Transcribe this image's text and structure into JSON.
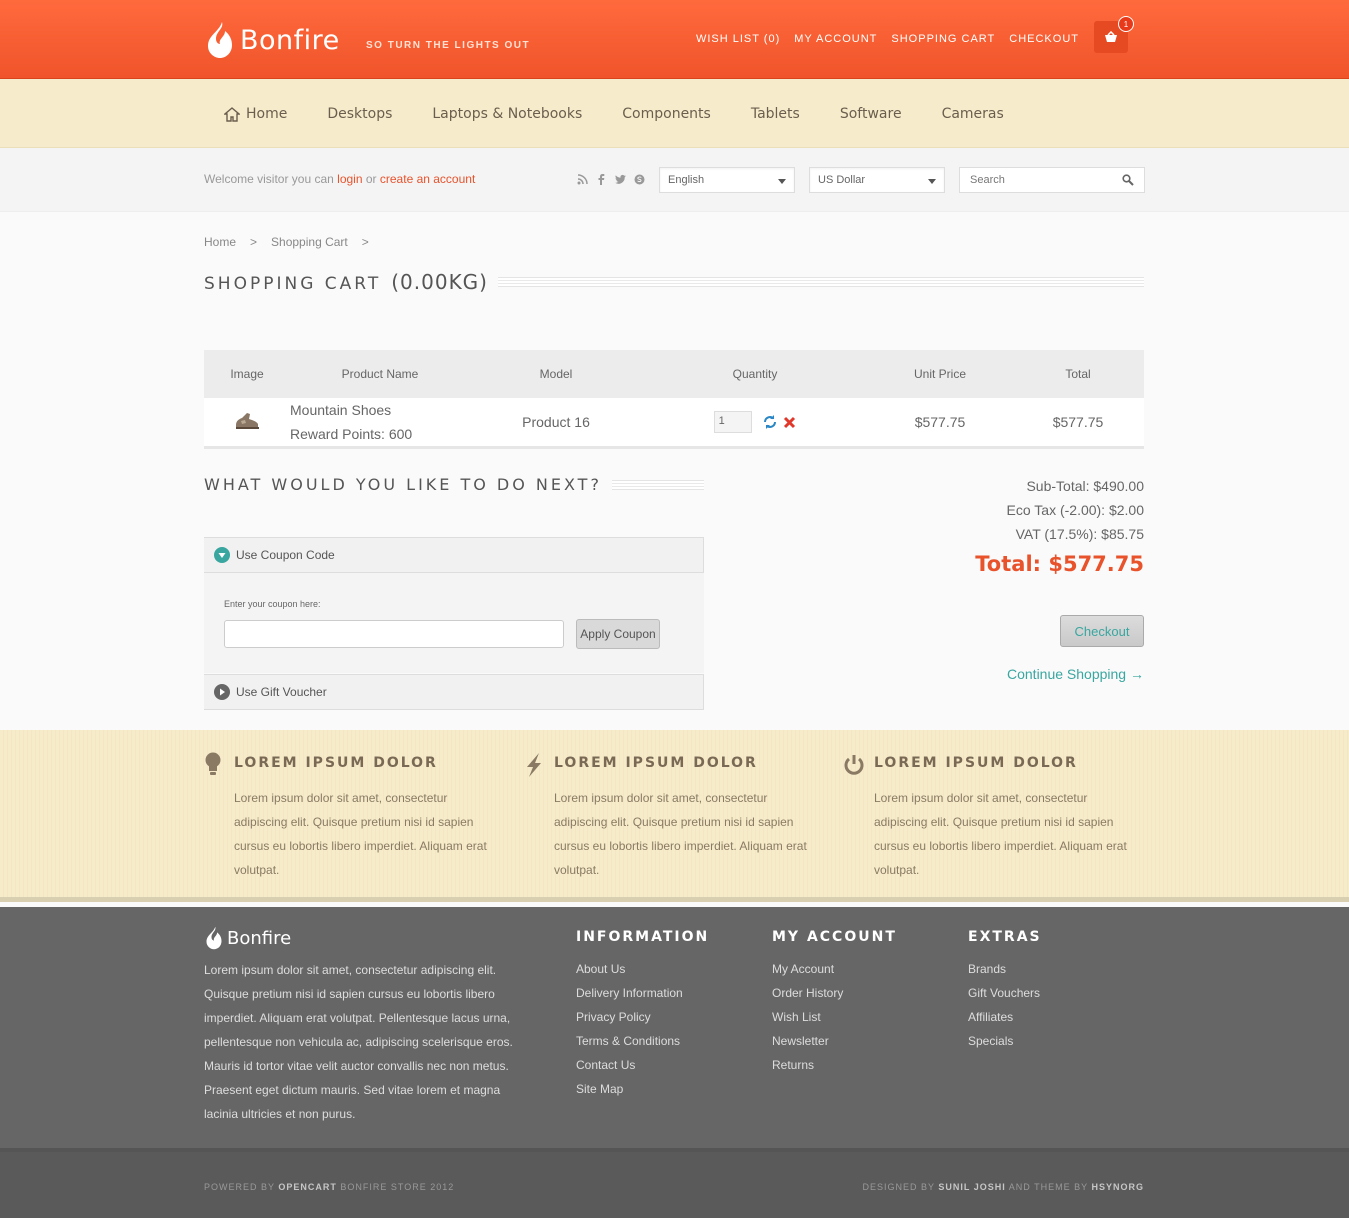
{
  "header": {
    "logo_text": "Bonfire",
    "tagline": "SO TURN THE LIGHTS OUT",
    "links": [
      "WISH LIST (0)",
      "MY ACCOUNT",
      "SHOPPING CART",
      "CHECKOUT"
    ],
    "cart_count": "1",
    "accent_color": "#f0542a"
  },
  "nav": {
    "items": [
      "Home",
      "Desktops",
      "Laptops & Notebooks",
      "Components",
      "Tablets",
      "Software",
      "Cameras"
    ]
  },
  "util": {
    "welcome_prefix": "Welcome visitor you can",
    "login": "login",
    "or": "or",
    "create": "create an account",
    "language": "English",
    "currency": "US Dollar",
    "search_placeholder": "Search",
    "social_icons": [
      "rss-icon",
      "facebook-icon",
      "twitter-icon",
      "skype-icon"
    ]
  },
  "breadcrumb": [
    "Home",
    ">",
    "Shopping Cart",
    ">"
  ],
  "page": {
    "title": "SHOPPING CART",
    "weight": "(0.00KG)"
  },
  "cart": {
    "headers": [
      "Image",
      "Product Name",
      "Model",
      "Quantity",
      "Unit Price",
      "Total"
    ],
    "rows": [
      {
        "name": "Mountain Shoes",
        "points": "Reward Points: 600",
        "model": "Product 16",
        "qty": "1",
        "unit_price": "$577.75",
        "total": "$577.75"
      }
    ]
  },
  "next": {
    "title": "WHAT WOULD YOU LIKE TO DO NEXT?",
    "coupon_title": "Use Coupon Code",
    "coupon_label": "Enter your coupon here:",
    "apply": "Apply Coupon",
    "voucher_title": "Use Gift Voucher"
  },
  "totals": {
    "subtotal": "Sub-Total: $490.00",
    "eco": "Eco Tax (-2.00): $2.00",
    "vat": "VAT (17.5%): $85.75",
    "total": "Total: $577.75",
    "checkout": "Checkout",
    "continue": "Continue Shopping →"
  },
  "features": [
    {
      "icon": "lightbulb-icon",
      "title": "LOREM IPSUM DOLOR",
      "text": "Lorem ipsum dolor sit amet, consectetur adipiscing elit. Quisque pretium nisi id sapien cursus eu lobortis libero imperdiet. Aliquam erat volutpat."
    },
    {
      "icon": "lightning-icon",
      "title": "LOREM IPSUM DOLOR",
      "text": "Lorem ipsum dolor sit amet, consectetur adipiscing elit. Quisque pretium nisi id sapien cursus eu lobortis libero imperdiet. Aliquam erat volutpat."
    },
    {
      "icon": "power-icon",
      "title": "LOREM IPSUM DOLOR",
      "text": "Lorem ipsum dolor sit amet, consectetur adipiscing elit. Quisque pretium nisi id sapien cursus eu lobortis libero imperdiet. Aliquam erat volutpat."
    }
  ],
  "footer": {
    "logo_text": "Bonfire",
    "about": "Lorem ipsum dolor sit amet, consectetur adipiscing elit. Quisque pretium nisi id sapien cursus eu lobortis libero imperdiet. Aliquam erat volutpat. Pellentesque lacus urna, pellentesque non vehicula ac, adipiscing scelerisque eros. Mauris id tortor vitae velit auctor convallis nec non metus. Praesent eget dictum mauris. Sed vitae lorem et magna lacinia ultricies et non purus.",
    "columns": [
      {
        "title": "INFORMATION",
        "items": [
          "About Us",
          "Delivery Information",
          "Privacy Policy",
          "Terms & Conditions",
          "Contact Us",
          "Site Map"
        ]
      },
      {
        "title": "MY ACCOUNT",
        "items": [
          "My Account",
          "Order History",
          "Wish List",
          "Newsletter",
          "Returns"
        ]
      },
      {
        "title": "EXTRAS",
        "items": [
          "Brands",
          "Gift Vouchers",
          "Affiliates",
          "Specials"
        ]
      }
    ],
    "powered_prefix": "POWERED BY",
    "powered_brand": "OPENCART",
    "powered_suffix": "BONFIRE STORE 2012",
    "designed_prefix": "DESIGNED BY",
    "designer": "SUNIL JOSHI",
    "theme_mid": "AND THEME BY",
    "theme_author": "HSYNORG"
  }
}
